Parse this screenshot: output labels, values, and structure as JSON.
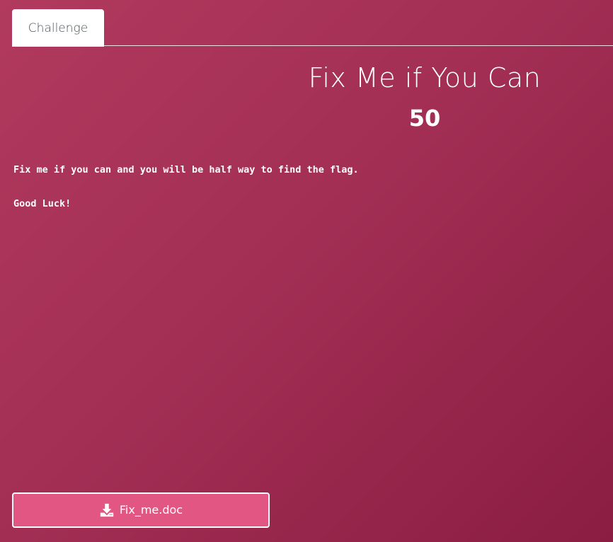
{
  "tabs": [
    {
      "label": "Challenge",
      "active": true
    }
  ],
  "challenge": {
    "title": "Fix Me if You Can",
    "points": "50",
    "description": [
      "Fix me if you can and you will be half way to find the flag.",
      "Good Luck!"
    ]
  },
  "file": {
    "label": "Fix_me.doc",
    "icon": "download-icon"
  },
  "colors": {
    "background_start": "#b13a5e",
    "background_end": "#8b1d42",
    "button": "#e25683",
    "tab_text": "#495057"
  }
}
